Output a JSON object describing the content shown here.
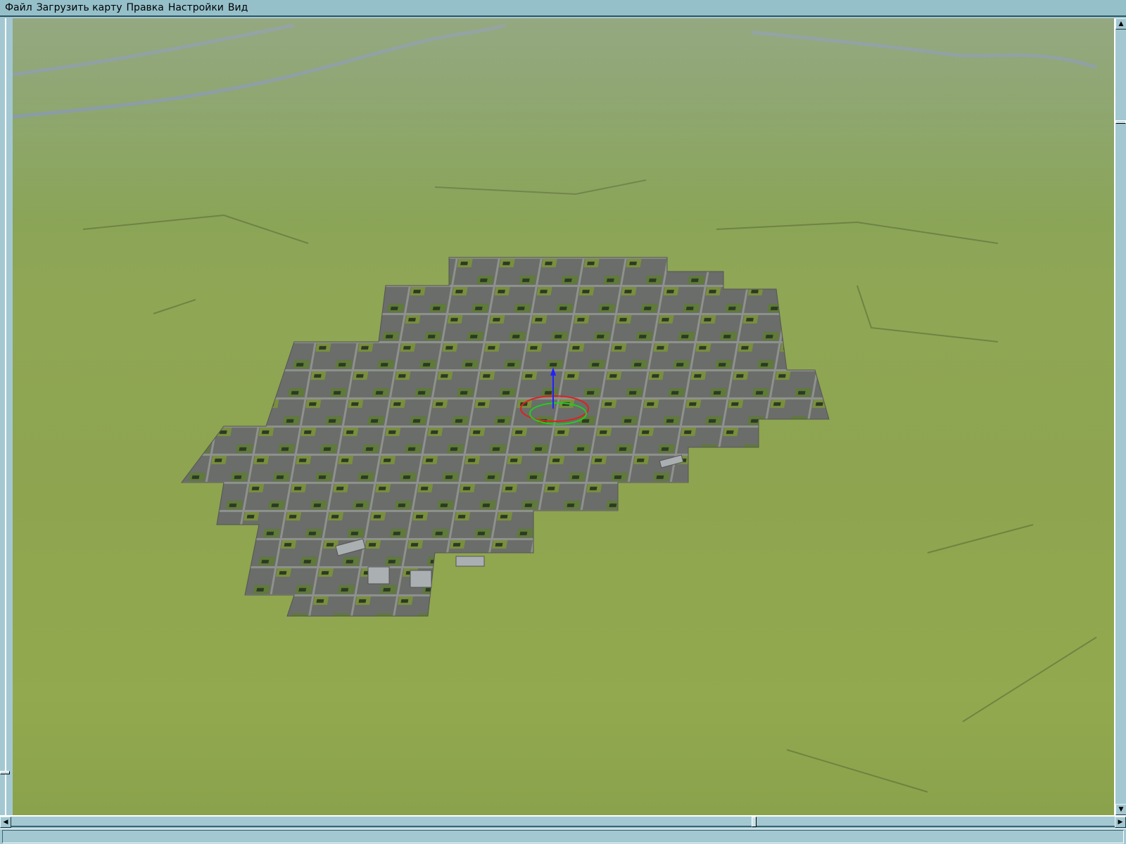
{
  "menu": {
    "items": [
      {
        "label": "Файл"
      },
      {
        "label": "Загрузить карту"
      },
      {
        "label": "Правка"
      },
      {
        "label": "Настройки"
      },
      {
        "label": "Вид"
      }
    ]
  },
  "status": {
    "text": ""
  },
  "scroll": {
    "vertical_position": 0.11,
    "horizontal_position": 0.68
  },
  "colors": {
    "ui": "#a3c8d2",
    "menu": "#95c0ca",
    "terrain": "#8ea44f",
    "tiles": "#6b6e6a"
  }
}
